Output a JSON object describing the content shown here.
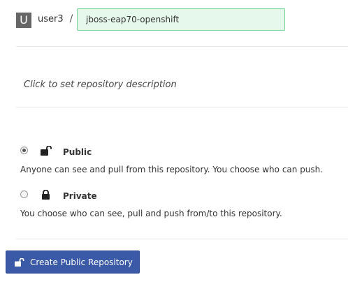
{
  "header": {
    "avatar_letter": "U",
    "namespace": "user3",
    "separator": "/",
    "repository_name": "jboss-eap70-openshift"
  },
  "description": {
    "placeholder": "Click to set repository description"
  },
  "visibility": {
    "selected": "public",
    "options": [
      {
        "title": "Public",
        "description": "Anyone can see and pull from this repository. You choose who can push.",
        "icon": "unlock-icon",
        "checked": true
      },
      {
        "title": "Private",
        "description": "You choose who can see, pull and push from/to this repository.",
        "icon": "lock-icon",
        "checked": false
      }
    ]
  },
  "actions": {
    "create_label": "Create Public Repository",
    "create_icon": "unlock-icon"
  },
  "colors": {
    "input_background": "#e6f7ec",
    "input_border": "#76d393",
    "button_background": "#3a5aa8",
    "avatar_background": "#666666"
  }
}
